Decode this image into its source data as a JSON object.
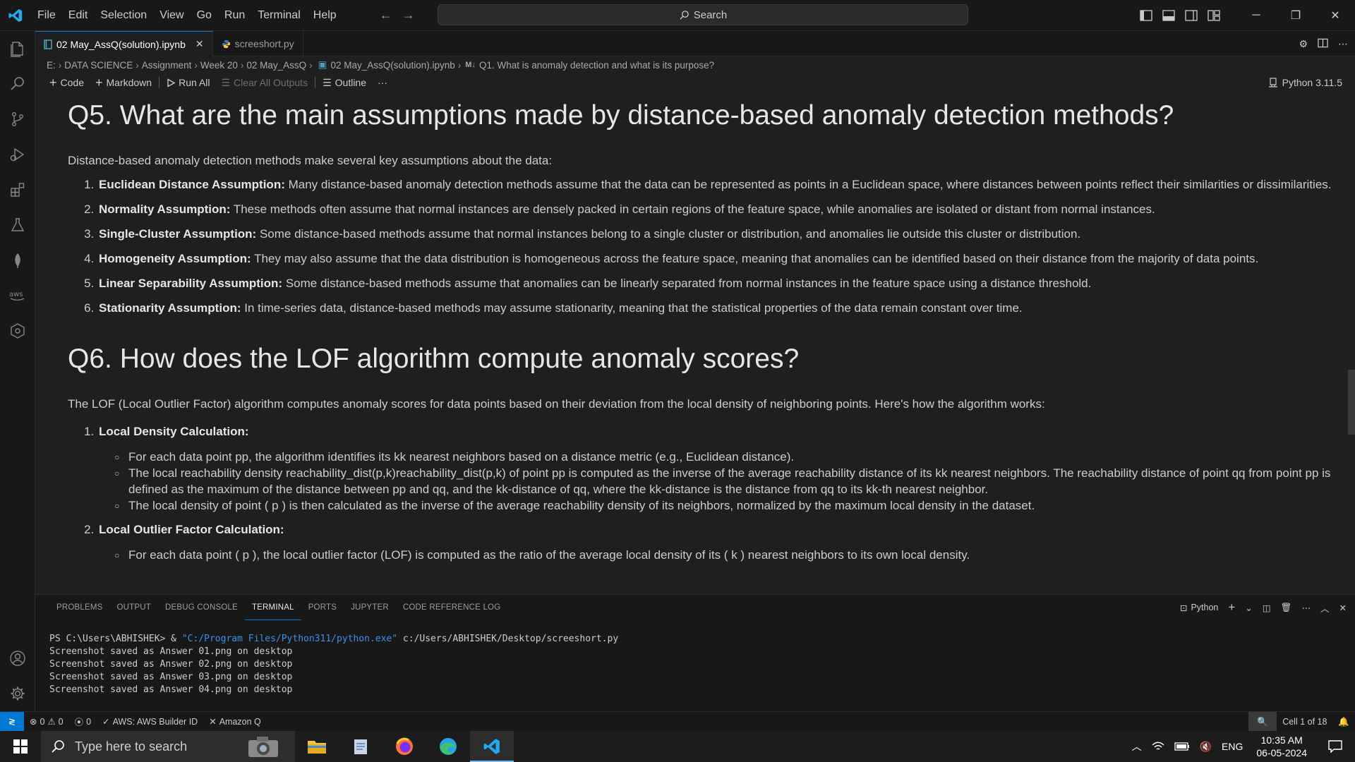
{
  "menu": [
    "File",
    "Edit",
    "Selection",
    "View",
    "Go",
    "Run",
    "Terminal",
    "Help"
  ],
  "search": {
    "label": "Search"
  },
  "tabs": [
    {
      "label": "02 May_AssQ(solution).ipynb",
      "active": true
    },
    {
      "label": "screeshort.py",
      "active": false
    }
  ],
  "breadcrumb": [
    "E:",
    "DATA SCIENCE",
    "Assignment",
    "Week 20",
    "02 May_AssQ",
    "02 May_AssQ(solution).ipynb",
    "Q1. What is anomaly detection and what is its purpose?"
  ],
  "toolbar": {
    "code": "Code",
    "markdown": "Markdown",
    "run_all": "Run All",
    "clear_outputs": "Clear All Outputs",
    "outline": "Outline",
    "more": "···",
    "kernel": "Python 3.11.5"
  },
  "notebook": {
    "q5_title": "Q5. What are the main assumptions made by distance-based anomaly detection methods?",
    "q5_intro": "Distance-based anomaly detection methods make several key assumptions about the data:",
    "q5_items": [
      {
        "title": "Euclidean Distance Assumption:",
        "text": " Many distance-based anomaly detection methods assume that the data can be represented as points in a Euclidean space, where distances between points reflect their similarities or dissimilarities."
      },
      {
        "title": "Normality Assumption:",
        "text": " These methods often assume that normal instances are densely packed in certain regions of the feature space, while anomalies are isolated or distant from normal instances."
      },
      {
        "title": "Single-Cluster Assumption:",
        "text": " Some distance-based methods assume that normal instances belong to a single cluster or distribution, and anomalies lie outside this cluster or distribution."
      },
      {
        "title": "Homogeneity Assumption:",
        "text": " They may also assume that the data distribution is homogeneous across the feature space, meaning that anomalies can be identified based on their distance from the majority of data points."
      },
      {
        "title": "Linear Separability Assumption:",
        "text": " Some distance-based methods assume that anomalies can be linearly separated from normal instances in the feature space using a distance threshold."
      },
      {
        "title": "Stationarity Assumption:",
        "text": " In time-series data, distance-based methods may assume stationarity, meaning that the statistical properties of the data remain constant over time."
      }
    ],
    "q6_title": "Q6. How does the LOF algorithm compute anomaly scores?",
    "q6_intro": "The LOF (Local Outlier Factor) algorithm computes anomaly scores for data points based on their deviation from the local density of neighboring points. Here's how the algorithm works:",
    "q6_step1_title": "Local Density Calculation:",
    "q6_step1_bullets": [
      "For each data point pp, the algorithm identifies its kk nearest neighbors based on a distance metric (e.g., Euclidean distance).",
      "The local reachability density reachability_dist(p,k)reachability_dist(p,k) of point pp is computed as the inverse of the average reachability distance of its kk nearest neighbors. The reachability distance of point qq from point pp is defined as the maximum of the distance between pp and qq, and the kk-distance of qq, where the kk-distance is the distance from qq to its kk-th nearest neighbor.",
      "The local density of point ( p ) is then calculated as the inverse of the average reachability density of its neighbors, normalized by the maximum local density in the dataset."
    ],
    "q6_step2_title": "Local Outlier Factor Calculation:",
    "q6_step2_bullets": [
      "For each data point ( p ), the local outlier factor (LOF) is computed as the ratio of the average local density of its ( k ) nearest neighbors to its own local density."
    ]
  },
  "panel": {
    "tabs": [
      "PROBLEMS",
      "OUTPUT",
      "DEBUG CONSOLE",
      "TERMINAL",
      "PORTS",
      "JUPYTER",
      "CODE REFERENCE LOG"
    ],
    "active_tab": "TERMINAL",
    "shell": "Python",
    "terminal": {
      "prompt": "PS C:\\Users\\ABHISHEK> & ",
      "exe": "\"C:/Program Files/Python311/python.exe\"",
      "arg": " c:/Users/ABHISHEK/Desktop/screeshort.py",
      "lines": [
        "Screenshot saved as Answer 01.png on desktop",
        "Screenshot saved as Answer 02.png on desktop",
        "Screenshot saved as Answer 03.png on desktop",
        "Screenshot saved as Answer 04.png on desktop"
      ]
    }
  },
  "status": {
    "errors": "0",
    "warnings": "0",
    "ports": "0",
    "aws": "AWS: AWS Builder ID",
    "amazon_q": "Amazon Q",
    "cell": "Cell 1 of 18"
  },
  "taskbar": {
    "search_placeholder": "Type here to search",
    "lang": "ENG",
    "time": "10:35 AM",
    "date": "06-05-2024"
  },
  "colors": {
    "accent": "#0078d4",
    "bg": "#1f1f1f",
    "chrome": "#181818"
  }
}
